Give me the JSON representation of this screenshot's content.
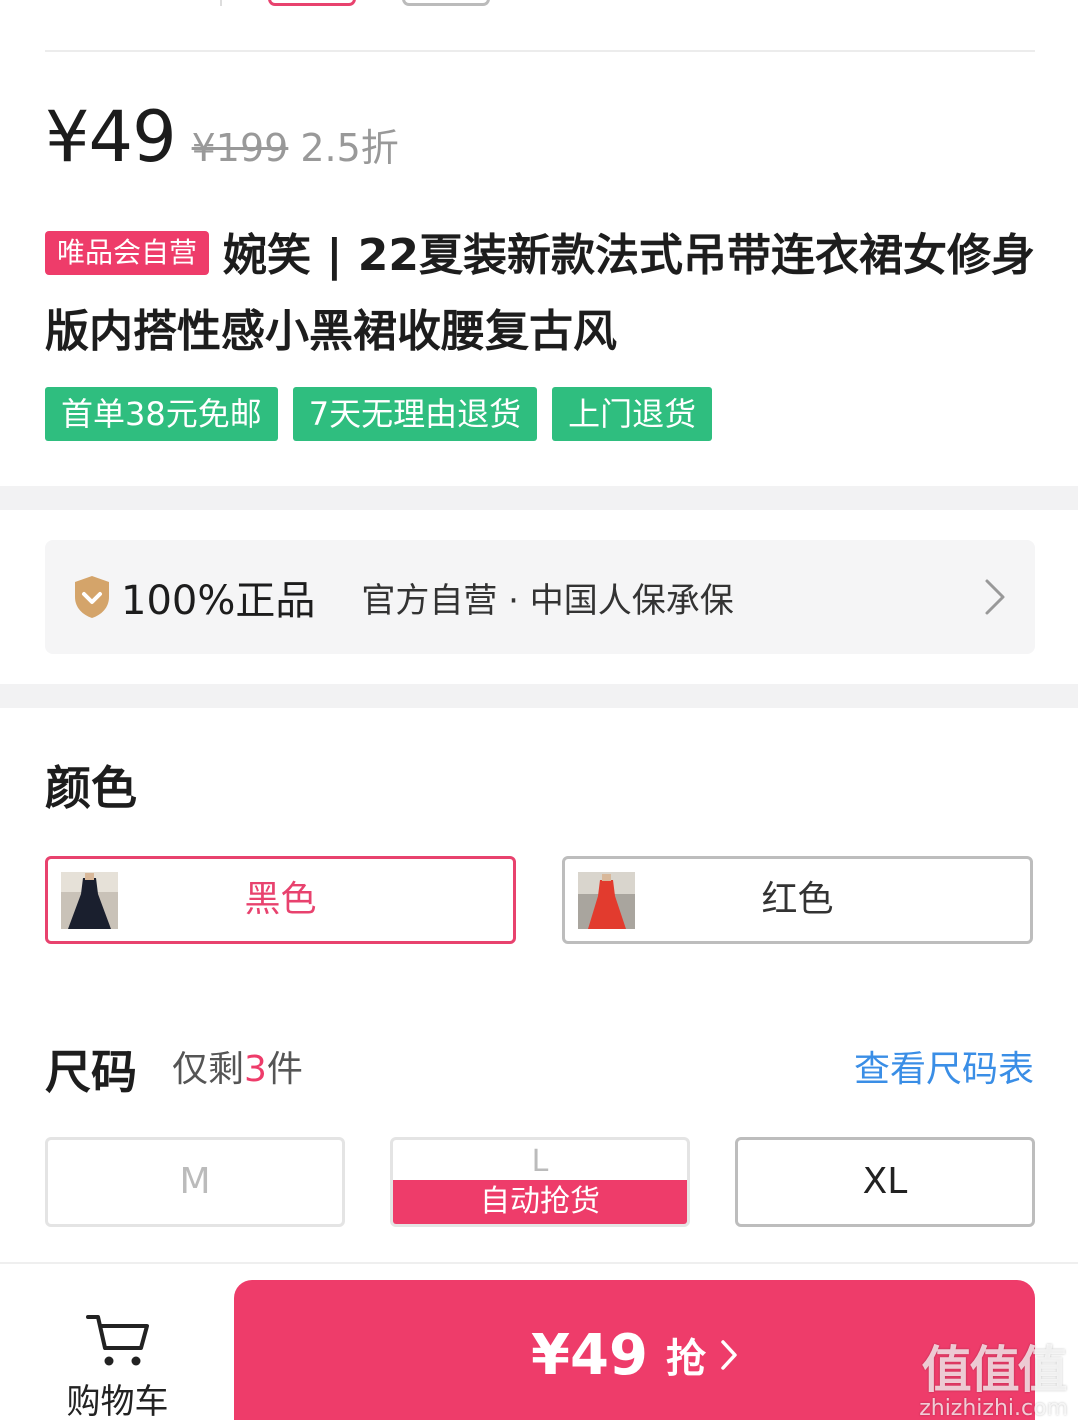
{
  "price": {
    "current": "¥49",
    "original": "¥199",
    "discount": "2.5折"
  },
  "product": {
    "badge": "唯品会自营",
    "title": "婉笑 | 22夏装新款法式吊带连衣裙女修身版内搭性感小黑裙收腰复古风"
  },
  "tags": [
    "首单38元免邮",
    "7天无理由退货",
    "上门退货"
  ],
  "guarantee": {
    "icon": "shield-check-icon",
    "title": "100%正品",
    "desc": "官方自营 · 中国人保承保"
  },
  "color": {
    "title": "颜色",
    "options": [
      {
        "label": "黑色",
        "selected": true,
        "swatch": "#1a1f2e"
      },
      {
        "label": "红色",
        "selected": false,
        "swatch": "#e23b2e"
      }
    ]
  },
  "size": {
    "title": "尺码",
    "stock_prefix": "仅剩",
    "stock_count": "3",
    "stock_suffix": "件",
    "chart_link": "查看尺码表",
    "options": [
      {
        "label": "M",
        "state": "disabled"
      },
      {
        "label": "L",
        "state": "auto",
        "auto_label": "自动抢货"
      },
      {
        "label": "XL",
        "state": "available"
      }
    ]
  },
  "bottom": {
    "cart_label": "购物车",
    "buy_price": "¥49",
    "buy_label": "抢"
  },
  "watermark": {
    "big": "值值值",
    "small": "zhizhizhi.com"
  },
  "colors": {
    "accent": "#ee3c6a",
    "tag_green": "#2fbe7f",
    "link_blue": "#3a8ee6"
  }
}
